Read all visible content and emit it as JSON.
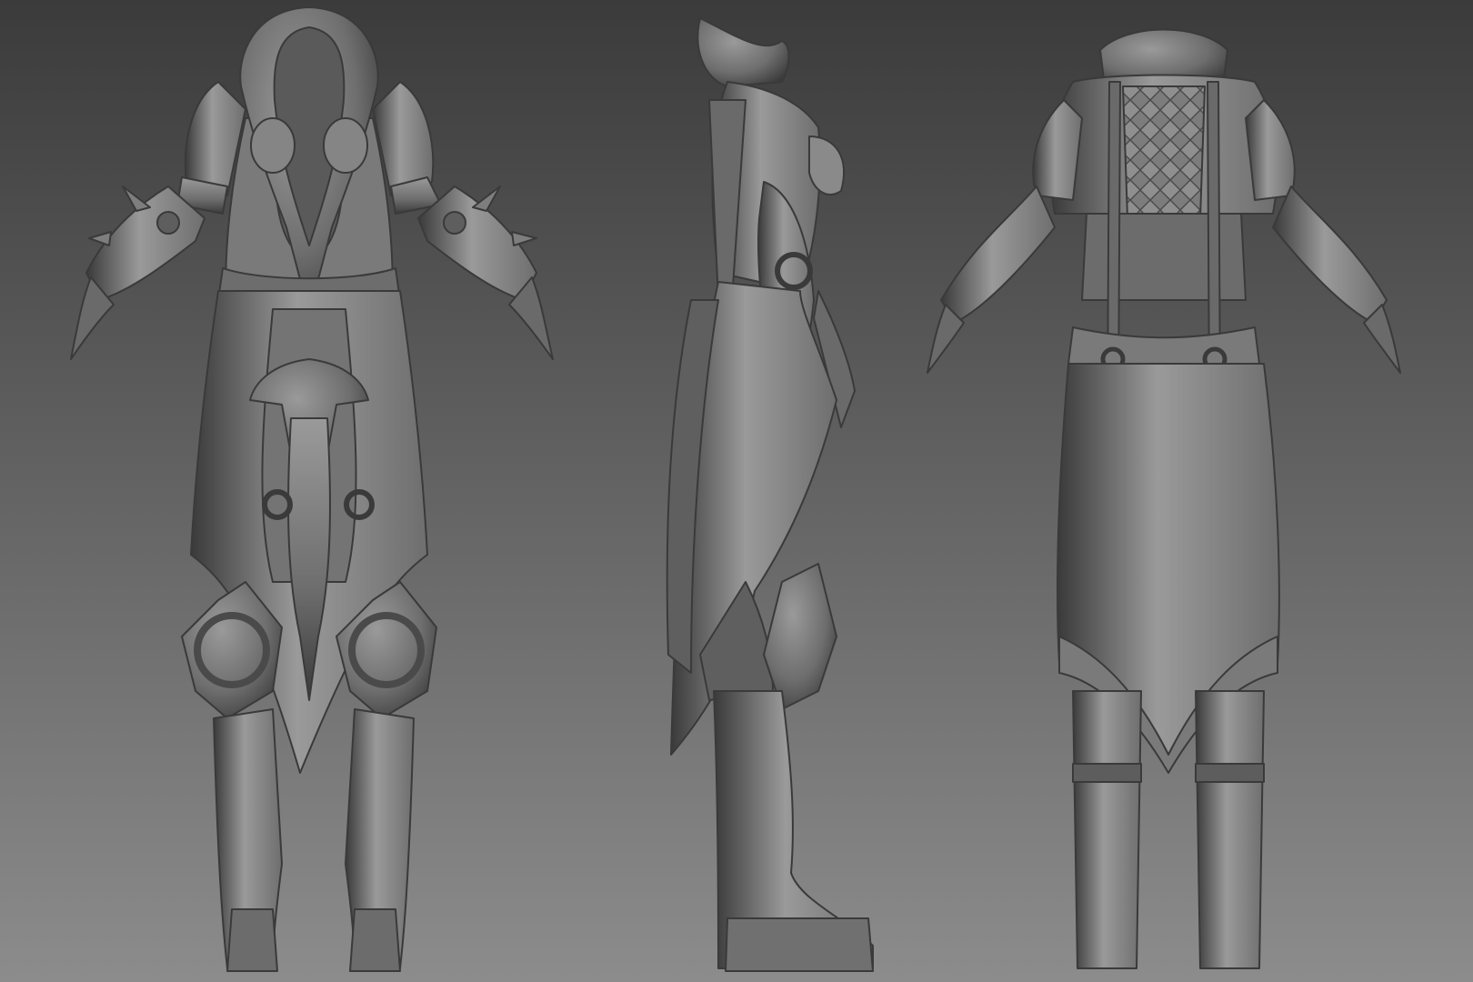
{
  "scene": {
    "background_top": "#3b3b3b",
    "background_bottom": "#8c8c8c",
    "material_light": "#9a9a9a",
    "material_mid": "#6e6e6e",
    "material_dark": "#3a3a3a",
    "views": [
      "front",
      "side",
      "back"
    ]
  }
}
